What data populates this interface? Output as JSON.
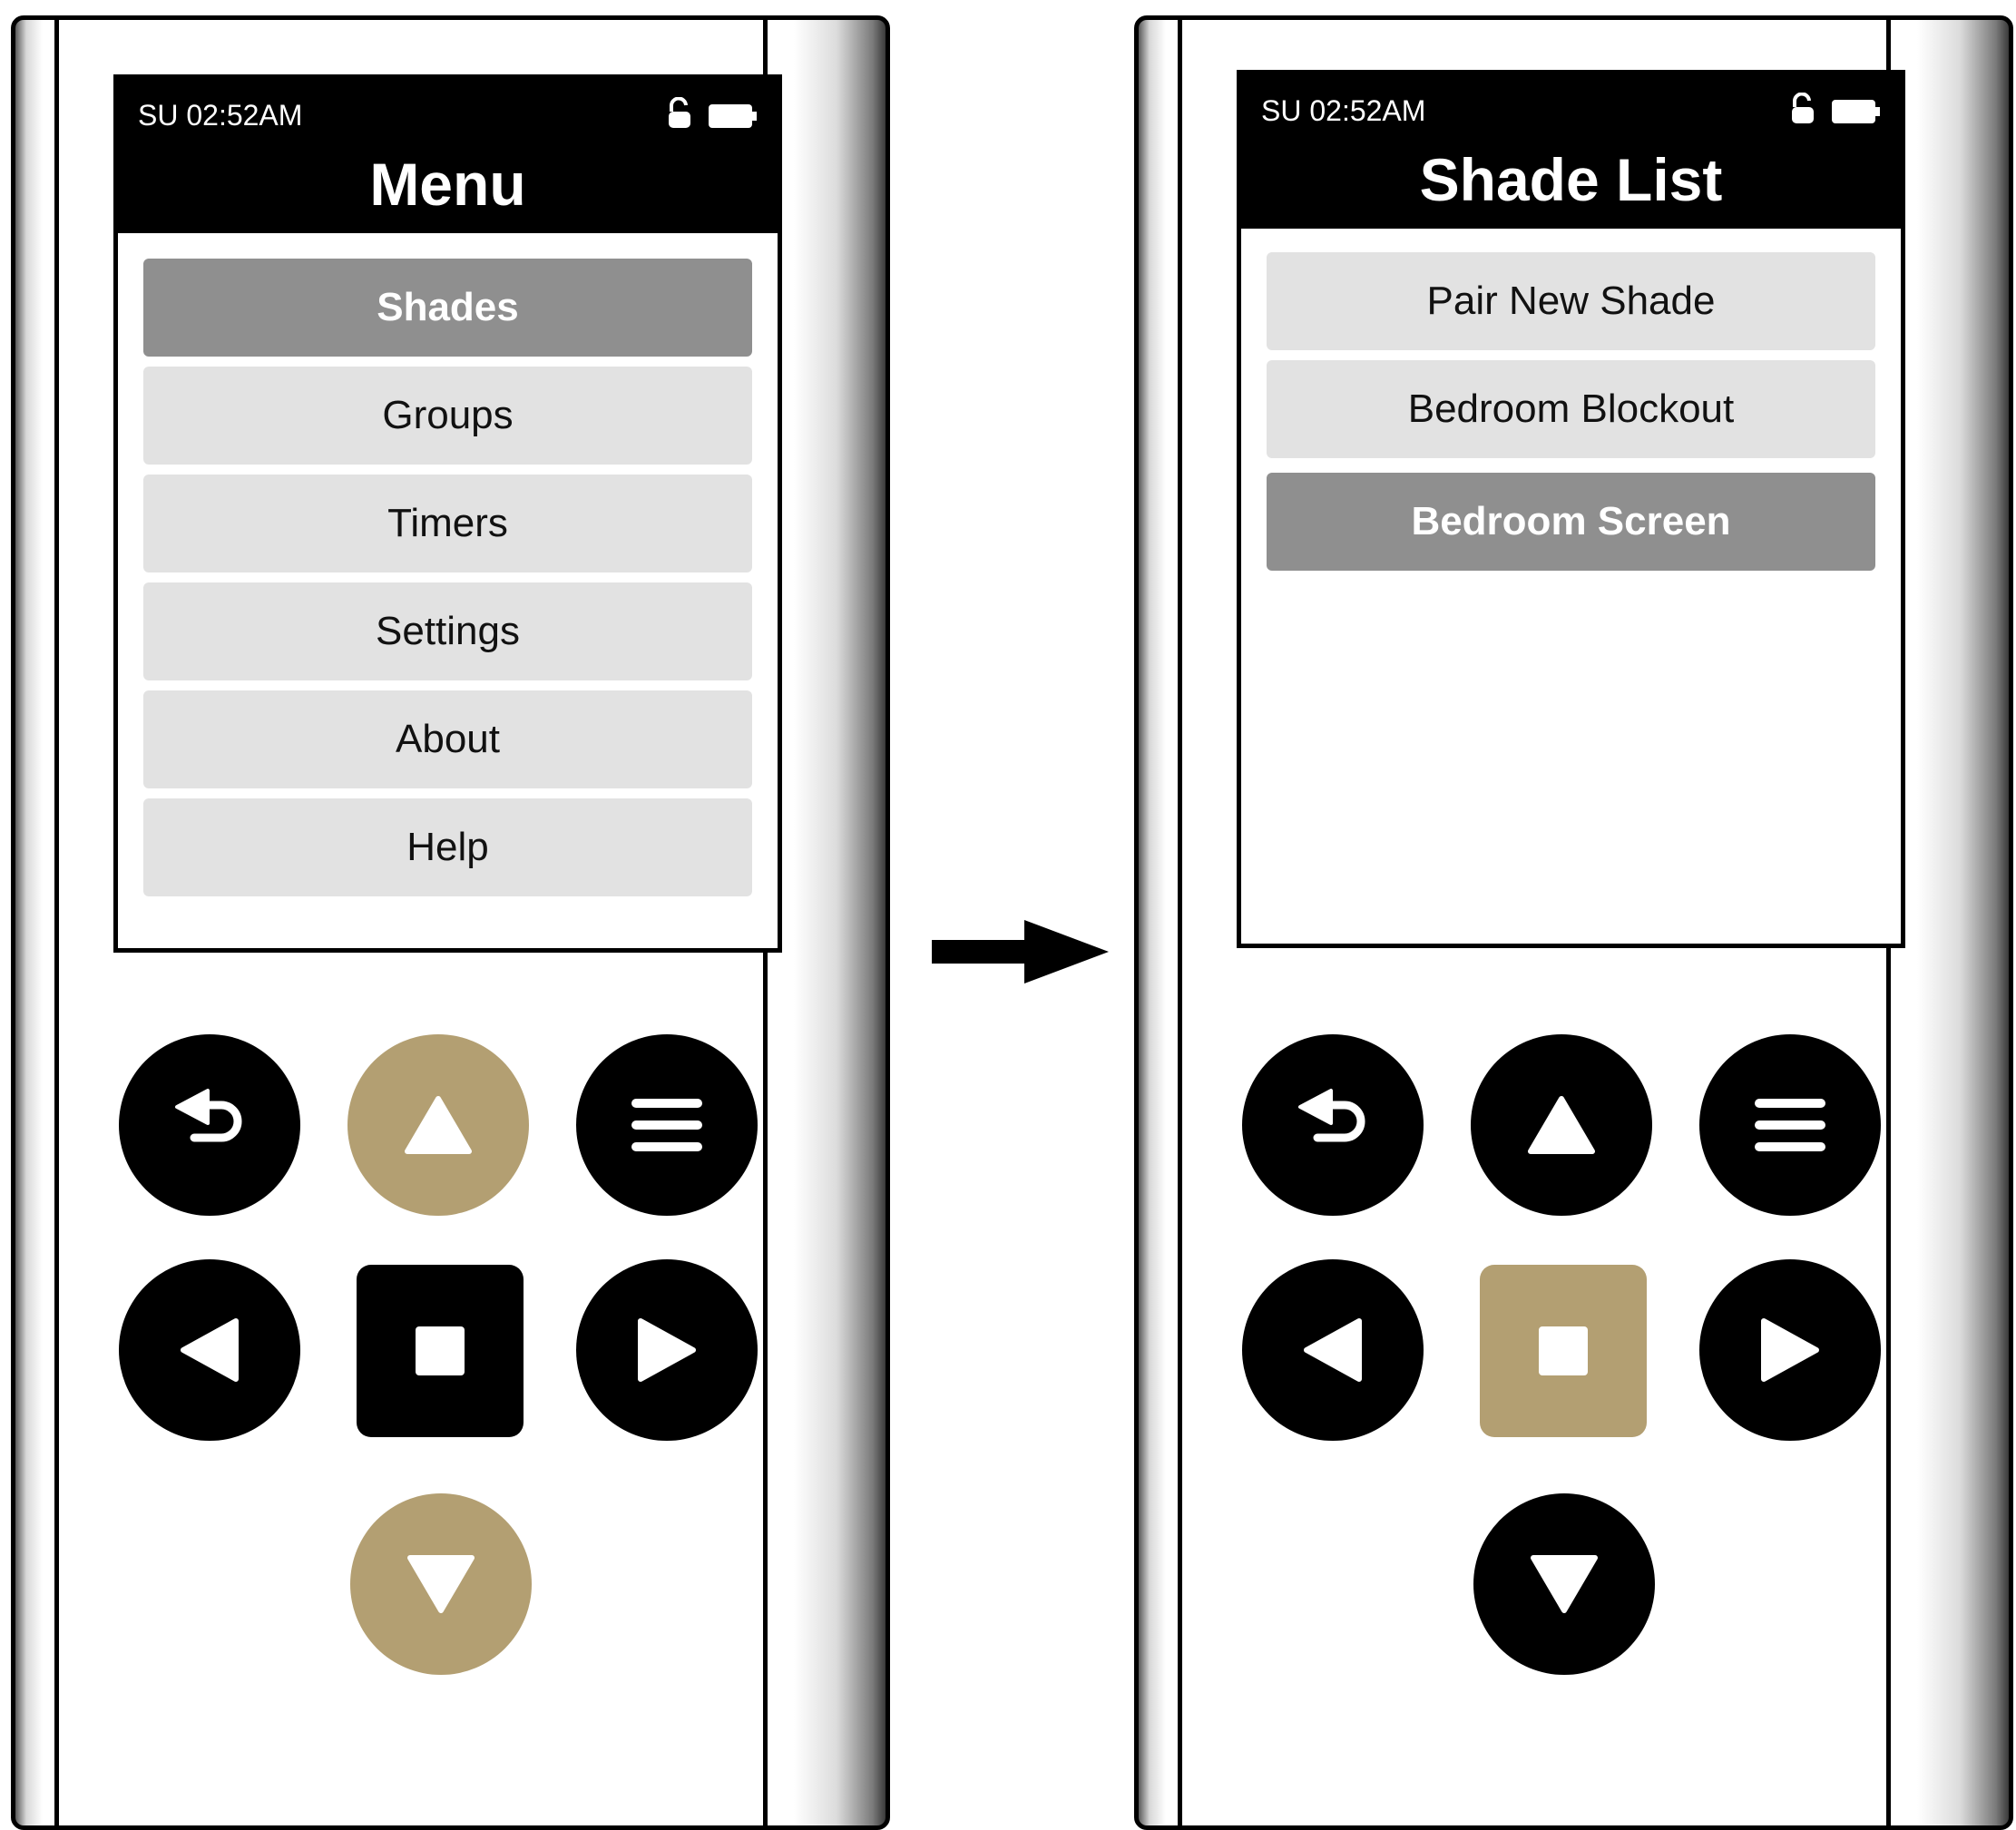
{
  "left_remote": {
    "status_time": "SU 02:52AM",
    "title": "Menu",
    "items": [
      {
        "label": "Shades",
        "selected": true
      },
      {
        "label": "Groups",
        "selected": false
      },
      {
        "label": "Timers",
        "selected": false
      },
      {
        "label": "Settings",
        "selected": false
      },
      {
        "label": "About",
        "selected": false
      },
      {
        "label": "Help",
        "selected": false
      }
    ],
    "highlighted_buttons": [
      "up-arrow-button",
      "down-arrow-button"
    ]
  },
  "right_remote": {
    "status_time": "SU 02:52AM",
    "title": "Shade List",
    "items": [
      {
        "label": "Pair New Shade",
        "selected": false
      },
      {
        "label": "Bedroom Blockout",
        "selected": false
      },
      {
        "label": "Bedroom Screen",
        "selected": true
      }
    ],
    "highlighted_buttons": [
      "stop-button"
    ]
  },
  "icons": {
    "status": [
      "unlock-icon",
      "battery-icon"
    ],
    "keypad": [
      "back-icon",
      "up-arrow-icon",
      "menu-icon",
      "left-arrow-icon",
      "stop-icon",
      "right-arrow-icon",
      "down-arrow-icon"
    ],
    "transition": "right-arrow-connector"
  },
  "colors": {
    "highlight": "#b39f72",
    "button": "#000000",
    "selected_item": "#8f8f8f",
    "item": "#e2e2e2"
  }
}
